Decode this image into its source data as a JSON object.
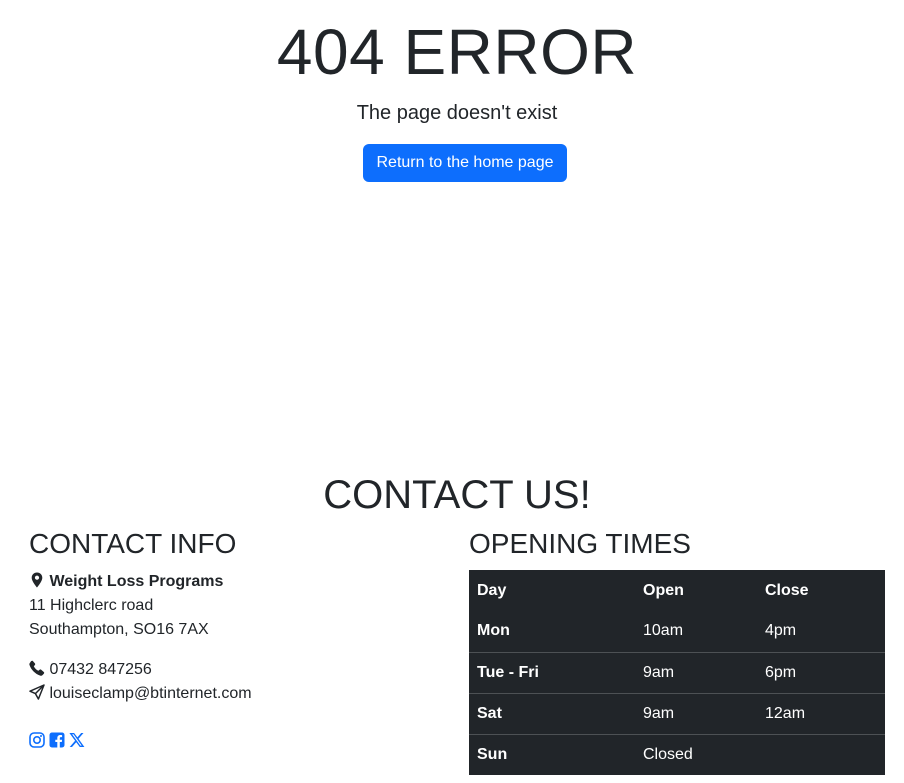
{
  "error": {
    "title": "404 ERROR",
    "subtitle": "The page doesn't exist",
    "home_button_label": "Return to the home page"
  },
  "contact": {
    "heading": "CONTACT US!",
    "info": {
      "title": "CONTACT INFO",
      "business_name": "Weight Loss Programs",
      "address_line1": "11 Highclerc road",
      "address_line2": "Southampton, SO16 7AX",
      "phone": "07432 847256",
      "email": "louiseclamp@btinternet.com",
      "icons": {
        "location": "map-marker-icon",
        "phone": "phone-icon",
        "email": "paper-plane-icon"
      },
      "social": [
        "instagram-icon",
        "facebook-icon",
        "x-twitter-icon"
      ]
    },
    "opening_times": {
      "title": "OPENING TIMES",
      "headers": [
        "Day",
        "Open",
        "Close"
      ],
      "rows": [
        [
          "Mon",
          "10am",
          "4pm"
        ],
        [
          "Tue - Fri",
          "9am",
          "6pm"
        ],
        [
          "Sat",
          "9am",
          "12am"
        ],
        [
          "Sun",
          "Closed",
          ""
        ]
      ]
    }
  },
  "colors": {
    "primary": "#0d6efd",
    "text": "#212529",
    "table_bg": "#212529"
  }
}
